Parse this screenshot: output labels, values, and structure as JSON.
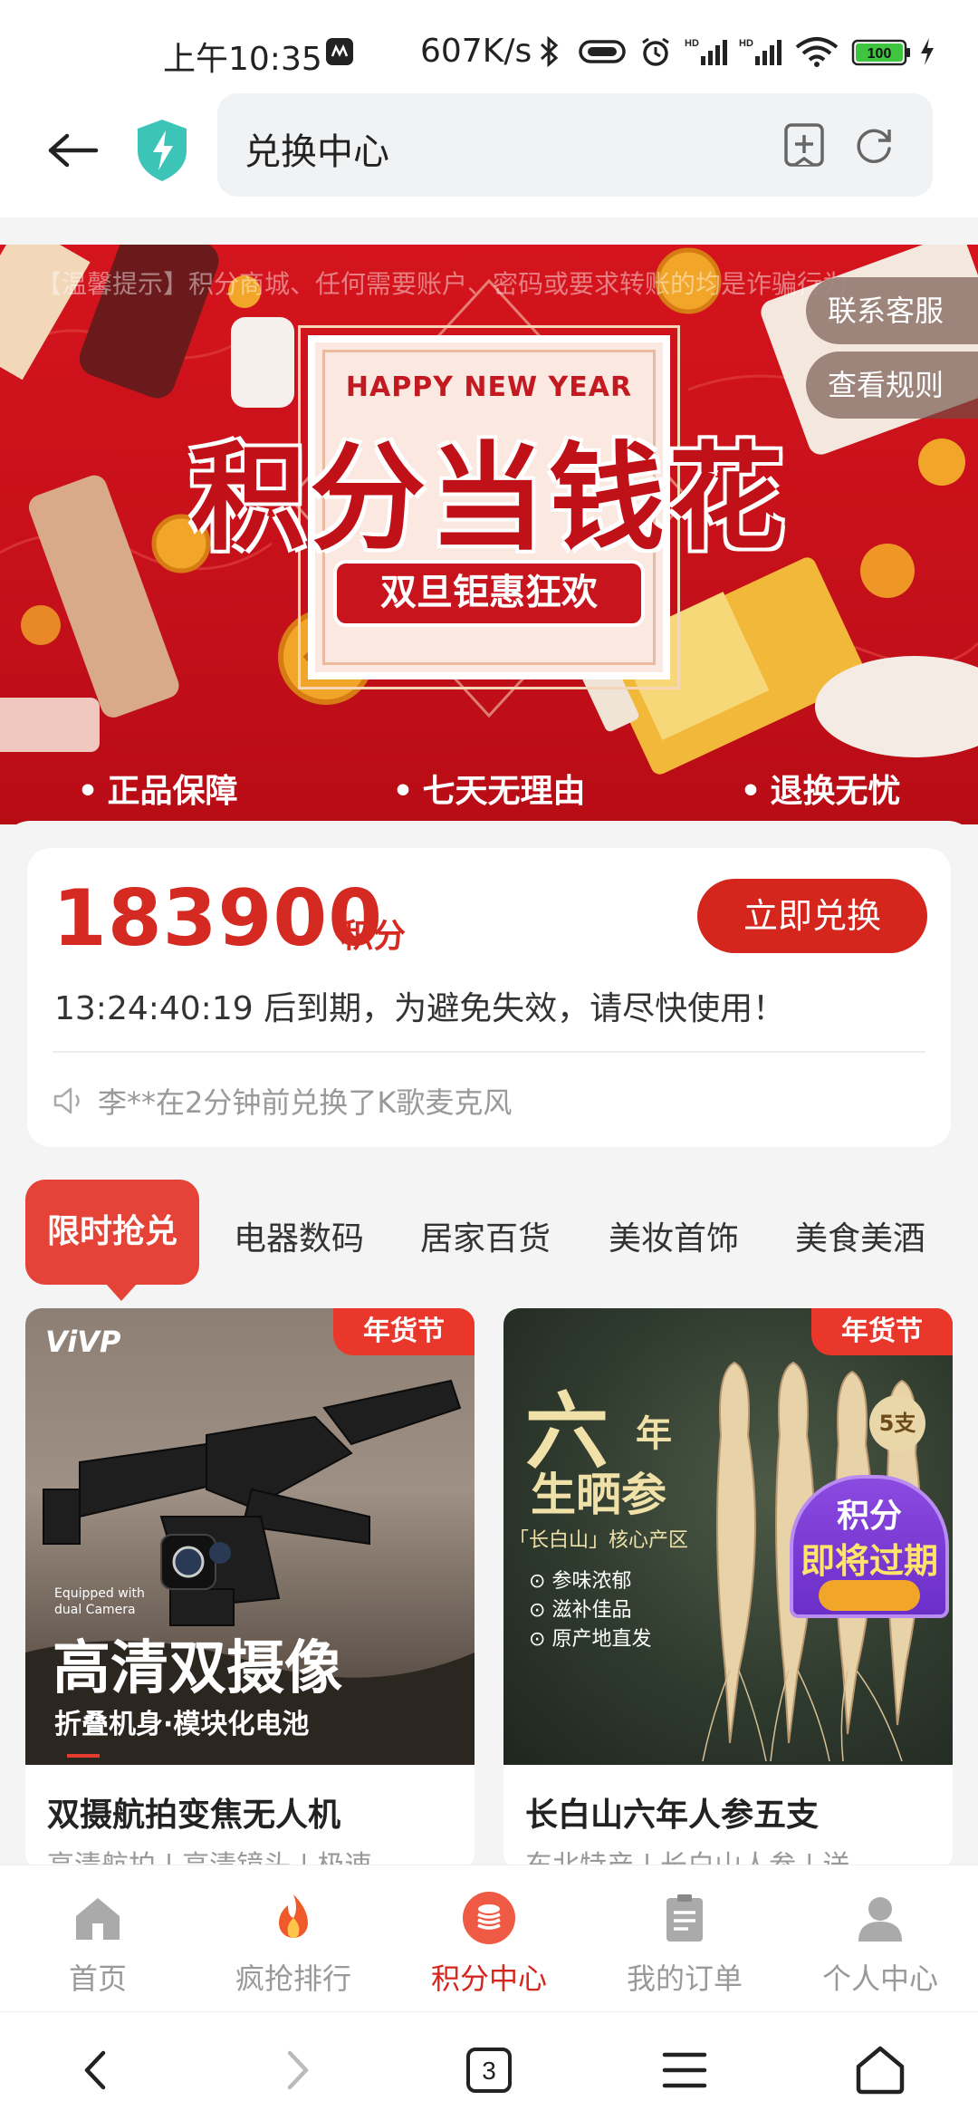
{
  "status_bar": {
    "time": "上午10:35",
    "speed": "607K/s",
    "battery": "100"
  },
  "url_bar": {
    "title": "兑换中心"
  },
  "banner": {
    "marquee": "【温馨提示】积分商城、任何需要账户、密码或要求转账的均是诈骗行为",
    "happy_new_year": "HAPPY NEW YEAR",
    "title": "积分当钱花",
    "subtitle": "双旦钜惠狂欢",
    "contact_button": "联系客服",
    "rules_button": "查看规则",
    "features": [
      "正品保障",
      "七天无理由",
      "退换无忧"
    ]
  },
  "points": {
    "value": "183900",
    "unit": "积分",
    "redeem_button": "立即兑换",
    "expire_text": "13:24:40:19 后到期，为避免失效，请尽快使用！",
    "notice": "李**在2分钟前兑换了K歌麦克风"
  },
  "category_tabs": [
    "限时抢兑",
    "电器数码",
    "居家百货",
    "美妆首饰",
    "美食美酒"
  ],
  "products": [
    {
      "tag": "年货节",
      "brand": "ViVP",
      "img_caption_small": "Equipped with dual Camera",
      "img_caption": "高清双摄像",
      "img_sub": "折叠机身·模块化电池",
      "name": "双摄航拍变焦无人机",
      "desc": "高清航拍 | 高清镜头 | 极速"
    },
    {
      "tag": "年货节",
      "img_title_1": "六",
      "img_title_2": "年",
      "img_title_3": "生晒参",
      "img_origin": "「长白山」核心产区",
      "img_points": [
        "参味浓郁",
        "滋补佳品",
        "原产地直发"
      ],
      "count_badge": "5支",
      "overlay_1": "积分",
      "overlay_2": "即将过期",
      "name": "长白山六年人参五支",
      "desc": "东北特产 | 长白山人参 | 送"
    }
  ],
  "bottom_tabs": [
    {
      "label": "首页",
      "icon": "home-icon"
    },
    {
      "label": "疯抢排行",
      "icon": "fire-icon"
    },
    {
      "label": "积分中心",
      "icon": "coins-icon"
    },
    {
      "label": "我的订单",
      "icon": "clipboard-icon"
    },
    {
      "label": "个人中心",
      "icon": "user-icon"
    }
  ],
  "system_nav": {
    "tab_count": "3"
  },
  "colors": {
    "accent": "#d5261e",
    "banner_red": "#c8141c",
    "tab_active": "#e64338"
  }
}
